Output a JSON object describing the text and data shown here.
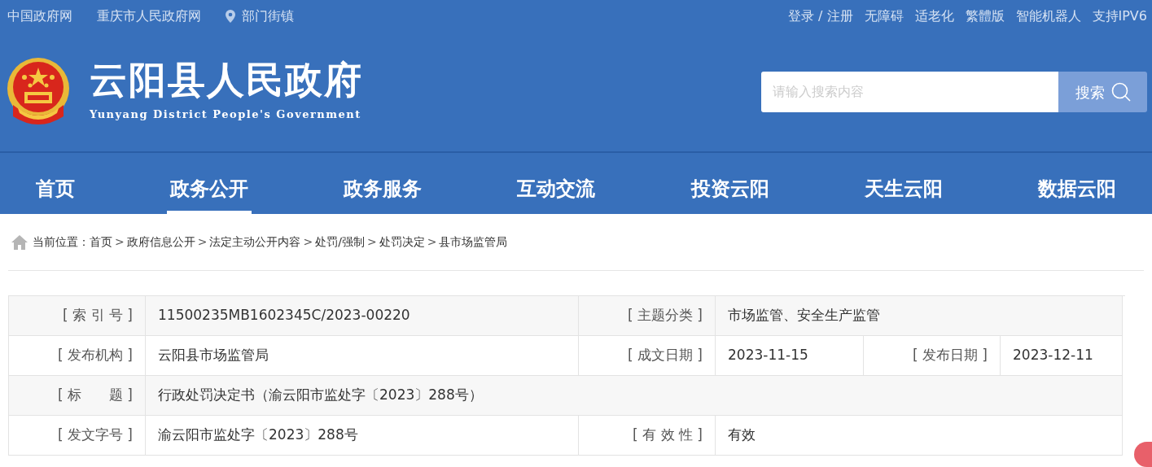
{
  "top_bar": {
    "left_links": [
      "中国政府网",
      "重庆市人民政府网"
    ],
    "dept_link": "部门街镇",
    "right_links": [
      "登录 / 注册",
      "无障碍",
      "适老化",
      "繁體版",
      "智能机器人",
      "支持IPV6"
    ]
  },
  "header": {
    "title": "云阳县人民政府",
    "subtitle": "Yunyang District People's Government",
    "search": {
      "placeholder": "请输入搜索内容",
      "button": "搜索"
    }
  },
  "nav": [
    {
      "label": "首页",
      "selected": false
    },
    {
      "label": "政务公开",
      "selected": true
    },
    {
      "label": "政务服务",
      "selected": false
    },
    {
      "label": "互动交流",
      "selected": false
    },
    {
      "label": "投资云阳",
      "selected": false
    },
    {
      "label": "天生云阳",
      "selected": false
    },
    {
      "label": "数据云阳",
      "selected": false
    }
  ],
  "breadcrumb": {
    "label": "当前位置：",
    "items": [
      {
        "text": "首页",
        "separator": ">"
      },
      {
        "text": "政府信息公开",
        "separator": ">"
      },
      {
        "text": "法定主动公开内容",
        "separator": ">"
      },
      {
        "text": "处罚/强制",
        "separator": ">"
      },
      {
        "text": "处罚决定",
        "separator": ">"
      },
      {
        "text": "县市场监管局"
      }
    ]
  },
  "info_table": {
    "rows": [
      [
        {
          "kind": "label",
          "text": "[ 索 引 号 ]"
        },
        {
          "kind": "value",
          "text": "11500235MB1602345C/2023-00220"
        },
        {
          "kind": "label",
          "text": "[ 主题分类 ]"
        },
        {
          "kind": "value",
          "text": "市场监管、安全生产监管"
        }
      ],
      [
        {
          "kind": "label",
          "text": "[ 发布机构 ]"
        },
        {
          "kind": "value",
          "text": "云阳县市场监管局"
        },
        {
          "kind": "label",
          "text": "[ 成文日期 ]"
        },
        {
          "kind": "value",
          "text": "2023-11-15"
        },
        {
          "kind": "label",
          "text": "[ 发布日期 ]"
        },
        {
          "kind": "value",
          "text": "2023-12-11"
        }
      ],
      [
        {
          "kind": "label",
          "text": "[ 标　　题 ]"
        },
        {
          "kind": "value",
          "text": "行政处罚决定书（渝云阳市监处字〔2023〕288号）"
        }
      ],
      [
        {
          "kind": "label",
          "text": "[ 发文字号 ]"
        },
        {
          "kind": "value",
          "text": "渝云阳市监处字〔2023〕288号"
        },
        {
          "kind": "label",
          "text": "[ 有 效 性 ]"
        },
        {
          "kind": "value",
          "text": "有效"
        }
      ]
    ]
  }
}
